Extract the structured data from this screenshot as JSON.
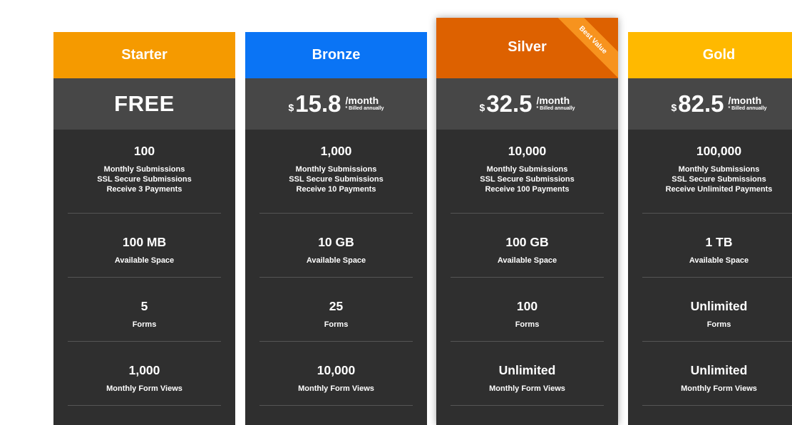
{
  "plans": [
    {
      "name": "Starter",
      "color": "#f59a00",
      "price_free": "FREE",
      "features": [
        {
          "value": "100",
          "lines": [
            "Monthly Submissions",
            "SSL Secure Submissions",
            "Receive 3 Payments"
          ]
        },
        {
          "value": "100 MB",
          "label": "Available Space"
        },
        {
          "value": "5",
          "label": "Forms"
        },
        {
          "value": "1,000",
          "label": "Monthly Form Views"
        }
      ]
    },
    {
      "name": "Bronze",
      "color": "#0a74f5",
      "currency": "$",
      "amount": "15.8",
      "period": "/month",
      "billed": "* Billed annually",
      "features": [
        {
          "value": "1,000",
          "lines": [
            "Monthly Submissions",
            "SSL Secure Submissions",
            "Receive 10 Payments"
          ]
        },
        {
          "value": "10 GB",
          "label": "Available Space"
        },
        {
          "value": "25",
          "label": "Forms"
        },
        {
          "value": "10,000",
          "label": "Monthly Form Views"
        }
      ]
    },
    {
      "name": "Silver",
      "color": "#dd6100",
      "currency": "$",
      "amount": "32.5",
      "period": "/month",
      "billed": "* Billed annually",
      "ribbon": "Best Value",
      "ribbon_color": "#f7931e",
      "features": [
        {
          "value": "10,000",
          "lines": [
            "Monthly Submissions",
            "SSL Secure Submissions",
            "Receive 100 Payments"
          ]
        },
        {
          "value": "100 GB",
          "label": "Available Space"
        },
        {
          "value": "100",
          "label": "Forms"
        },
        {
          "value": "Unlimited",
          "label": "Monthly Form Views"
        }
      ]
    },
    {
      "name": "Gold",
      "color": "#ffb900",
      "currency": "$",
      "amount": "82.5",
      "period": "/month",
      "billed": "* Billed annually",
      "features": [
        {
          "value": "100,000",
          "lines": [
            "Monthly Submissions",
            "SSL Secure Submissions",
            "Receive Unlimited Payments"
          ]
        },
        {
          "value": "1 TB",
          "label": "Available Space"
        },
        {
          "value": "Unlimited",
          "label": "Forms"
        },
        {
          "value": "Unlimited",
          "label": "Monthly Form Views"
        }
      ]
    }
  ]
}
